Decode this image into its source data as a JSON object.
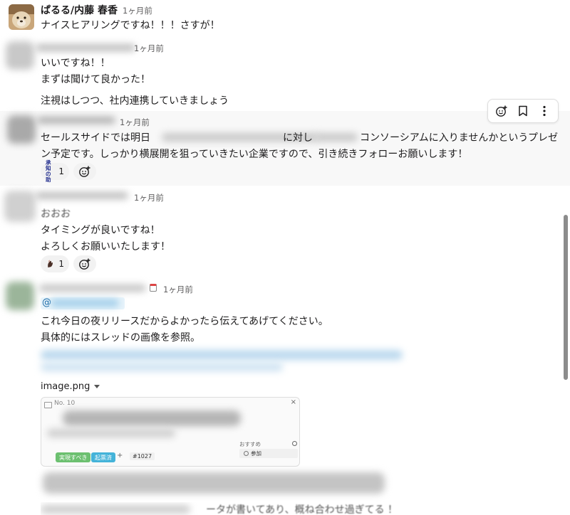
{
  "messages": [
    {
      "author": "ぱるる/内藤 春香",
      "time": "1ヶ月前",
      "lines": [
        "ナイスヒアリングですね！！！さすが！"
      ]
    },
    {
      "time": "1ヶ月前",
      "lines": [
        "いいですね！！",
        "まずは聞けて良かった！",
        "注視はしつつ、社内連携していきましょう"
      ]
    },
    {
      "time": "1ヶ月前",
      "line1_parts": [
        "セールスサイドでは明日",
        "に対し",
        "コンソーシアムに入りませんかというプレゼ"
      ],
      "line2": "ン予定です。しっかり横展開を狙っていきたい企業ですので、引き続きフォローお願いします！",
      "reaction": {
        "emoji": "承知の助",
        "emoji_top": "承知",
        "emoji_bottom": "の助",
        "count": "1"
      }
    },
    {
      "time": "1ヶ月前",
      "lines": [
        "おおお",
        "タイミングが良いですね！",
        "よろしくお願いいたします！"
      ],
      "reaction": {
        "emoji": "hand",
        "count": "1"
      }
    },
    {
      "time": "1ヶ月前",
      "mention": "@",
      "lines": [
        "これ今日の夜リリースだからよかったら伝えてあげてください。",
        "具体的にはスレッドの画像を参照。"
      ],
      "attachment": {
        "filename": "image.png",
        "preview": {
          "ticket": "No. 10",
          "tag_primary": "実現すべき",
          "tag_secondary": "起票済",
          "plus": "+",
          "ticket_ref": "#1027",
          "side_title": "おすすめ",
          "side_item": "参加",
          "close": "×"
        }
      },
      "trailing_text": "ータが書いてあり、概ね合わせ過ぎてる ！"
    }
  ],
  "toolbar": {
    "buttons": [
      "add-reaction",
      "bookmark",
      "more-actions"
    ]
  },
  "colors": {
    "hover_bg": "#f8f8f8",
    "tag_green": "#6cc070",
    "tag_blue": "#44b3d9",
    "reaction_bg": "#f2f2f2",
    "scrollbar": "#8c8c8c"
  }
}
